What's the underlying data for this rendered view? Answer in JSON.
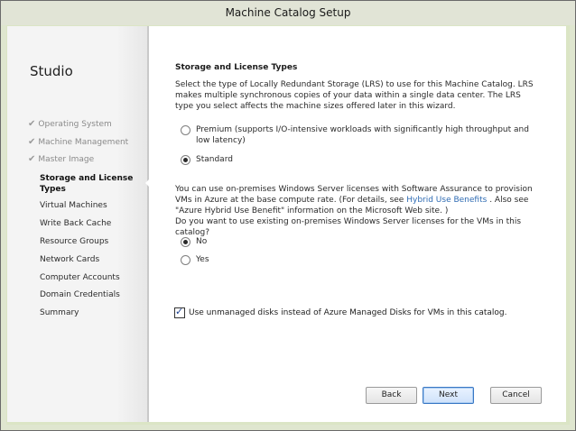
{
  "window": {
    "title": "Machine Catalog Setup"
  },
  "sidebar": {
    "brand": "Studio",
    "steps": [
      {
        "label": "Operating System",
        "state": "done"
      },
      {
        "label": "Machine Management",
        "state": "done"
      },
      {
        "label": "Master Image",
        "state": "done"
      },
      {
        "label": "Storage and License Types",
        "state": "current"
      },
      {
        "label": "Virtual Machines",
        "state": "pending"
      },
      {
        "label": "Write Back Cache",
        "state": "pending"
      },
      {
        "label": "Resource Groups",
        "state": "pending"
      },
      {
        "label": "Network Cards",
        "state": "pending"
      },
      {
        "label": "Computer Accounts",
        "state": "pending"
      },
      {
        "label": "Domain Credentials",
        "state": "pending"
      },
      {
        "label": "Summary",
        "state": "pending"
      }
    ]
  },
  "main": {
    "title": "Storage and License Types",
    "intro": "Select the type of Locally Redundant Storage (LRS) to use for this Machine Catalog. LRS makes multiple synchronous copies of your data within a single data center. The LRS type you select affects the machine sizes offered later in this wizard.",
    "storage_options": [
      {
        "label": "Premium (supports I/O-intensive workloads with significantly high throughput and low latency)",
        "selected": false
      },
      {
        "label": "Standard",
        "selected": true
      }
    ],
    "license_text_1": "You can use on-premises Windows Server licenses with Software Assurance to provision VMs in Azure at the base compute rate. (For details, see ",
    "license_link": "Hybrid Use Benefits",
    "license_text_2": " . Also see \"Azure Hybrid Use Benefit\" information on the Microsoft Web site. )",
    "license_question": "Do you want to use existing on-premises Windows Server licenses for the VMs in this catalog?",
    "license_options": [
      {
        "label": "No",
        "selected": true
      },
      {
        "label": "Yes",
        "selected": false
      }
    ],
    "unmanaged_disks": {
      "label": "Use unmanaged disks instead of Azure Managed Disks for VMs in this catalog.",
      "checked": true
    }
  },
  "buttons": {
    "back": "Back",
    "next": "Next",
    "cancel": "Cancel"
  }
}
